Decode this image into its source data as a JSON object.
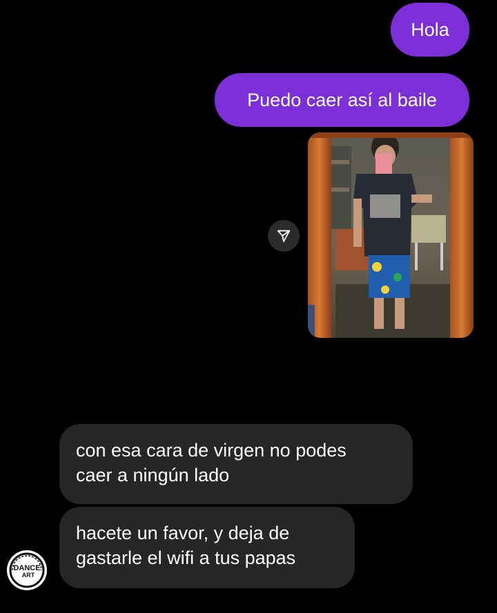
{
  "conversation": {
    "sent": [
      {
        "text": "Hola"
      },
      {
        "text": "Puedo caer así al baile"
      }
    ],
    "photo": {
      "icon": "mirror-selfie-photo",
      "share_icon": "send-paper-plane-icon"
    },
    "received": [
      {
        "lines": [
          "con esa cara de virgen no podes",
          "caer a ningún lado"
        ]
      },
      {
        "lines": [
          "hacete un favor, y deja de",
          "gastarle el wifi a tus papas"
        ]
      }
    ],
    "sender_avatar": {
      "logo_text_top": "DANCE",
      "logo_text_bottom": "ART"
    }
  },
  "colors": {
    "sent_bubble": "#7c2fd6",
    "received_bubble": "#262626",
    "background": "#000000"
  }
}
